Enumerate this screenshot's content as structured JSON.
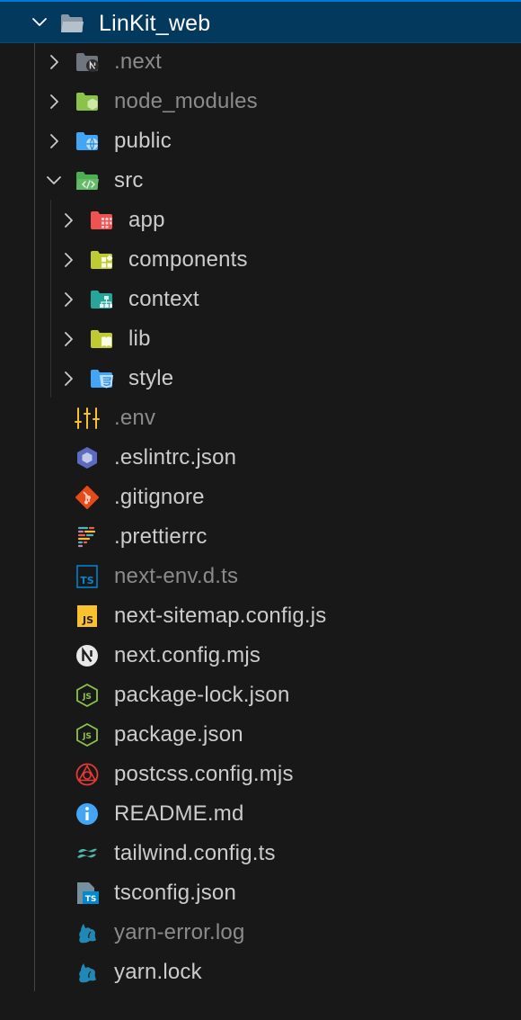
{
  "root": {
    "label": "LinKit_web",
    "icon": "folder-open-icon",
    "expanded": true
  },
  "items": [
    {
      "label": ".next",
      "depth": 1,
      "type": "folder",
      "icon": "next-folder-icon",
      "dimmed": true
    },
    {
      "label": "node_modules",
      "depth": 1,
      "type": "folder",
      "icon": "node-folder-icon",
      "dimmed": true
    },
    {
      "label": "public",
      "depth": 1,
      "type": "folder",
      "icon": "globe-folder-icon",
      "dimmed": false
    },
    {
      "label": "src",
      "depth": 1,
      "type": "folder-open",
      "icon": "src-folder-icon",
      "dimmed": false
    },
    {
      "label": "app",
      "depth": 2,
      "type": "folder",
      "icon": "app-folder-icon",
      "dimmed": false
    },
    {
      "label": "components",
      "depth": 2,
      "type": "folder",
      "icon": "components-folder-icon",
      "dimmed": false
    },
    {
      "label": "context",
      "depth": 2,
      "type": "folder",
      "icon": "context-folder-icon",
      "dimmed": false
    },
    {
      "label": "lib",
      "depth": 2,
      "type": "folder",
      "icon": "lib-folder-icon",
      "dimmed": false
    },
    {
      "label": "style",
      "depth": 2,
      "type": "folder",
      "icon": "style-folder-icon",
      "dimmed": false
    },
    {
      "label": ".env",
      "depth": 1,
      "type": "file",
      "icon": "env-icon",
      "dimmed": true
    },
    {
      "label": ".eslintrc.json",
      "depth": 1,
      "type": "file",
      "icon": "eslint-icon",
      "dimmed": false
    },
    {
      "label": ".gitignore",
      "depth": 1,
      "type": "file",
      "icon": "git-icon",
      "dimmed": false
    },
    {
      "label": ".prettierrc",
      "depth": 1,
      "type": "file",
      "icon": "prettier-icon",
      "dimmed": false
    },
    {
      "label": "next-env.d.ts",
      "depth": 1,
      "type": "file",
      "icon": "typescript-icon",
      "dimmed": true
    },
    {
      "label": "next-sitemap.config.js",
      "depth": 1,
      "type": "file",
      "icon": "javascript-icon",
      "dimmed": false
    },
    {
      "label": "next.config.mjs",
      "depth": 1,
      "type": "file",
      "icon": "nextjs-icon",
      "dimmed": false
    },
    {
      "label": "package-lock.json",
      "depth": 1,
      "type": "file",
      "icon": "nodejs-icon",
      "dimmed": false
    },
    {
      "label": "package.json",
      "depth": 1,
      "type": "file",
      "icon": "nodejs-icon",
      "dimmed": false
    },
    {
      "label": "postcss.config.mjs",
      "depth": 1,
      "type": "file",
      "icon": "postcss-icon",
      "dimmed": false
    },
    {
      "label": "README.md",
      "depth": 1,
      "type": "file",
      "icon": "info-icon",
      "dimmed": false
    },
    {
      "label": "tailwind.config.ts",
      "depth": 1,
      "type": "file",
      "icon": "tailwind-icon",
      "dimmed": false
    },
    {
      "label": "tsconfig.json",
      "depth": 1,
      "type": "file",
      "icon": "tsconfig-icon",
      "dimmed": false
    },
    {
      "label": "yarn-error.log",
      "depth": 1,
      "type": "file",
      "icon": "yarn-icon",
      "dimmed": true
    },
    {
      "label": "yarn.lock",
      "depth": 1,
      "type": "file",
      "icon": "yarn-icon",
      "dimmed": false
    }
  ],
  "colors": {
    "background": "#181818",
    "selection": "#04395e",
    "focus_border": "#0078d4",
    "text": "#cccccc",
    "text_dimmed": "#8b8b8b"
  }
}
